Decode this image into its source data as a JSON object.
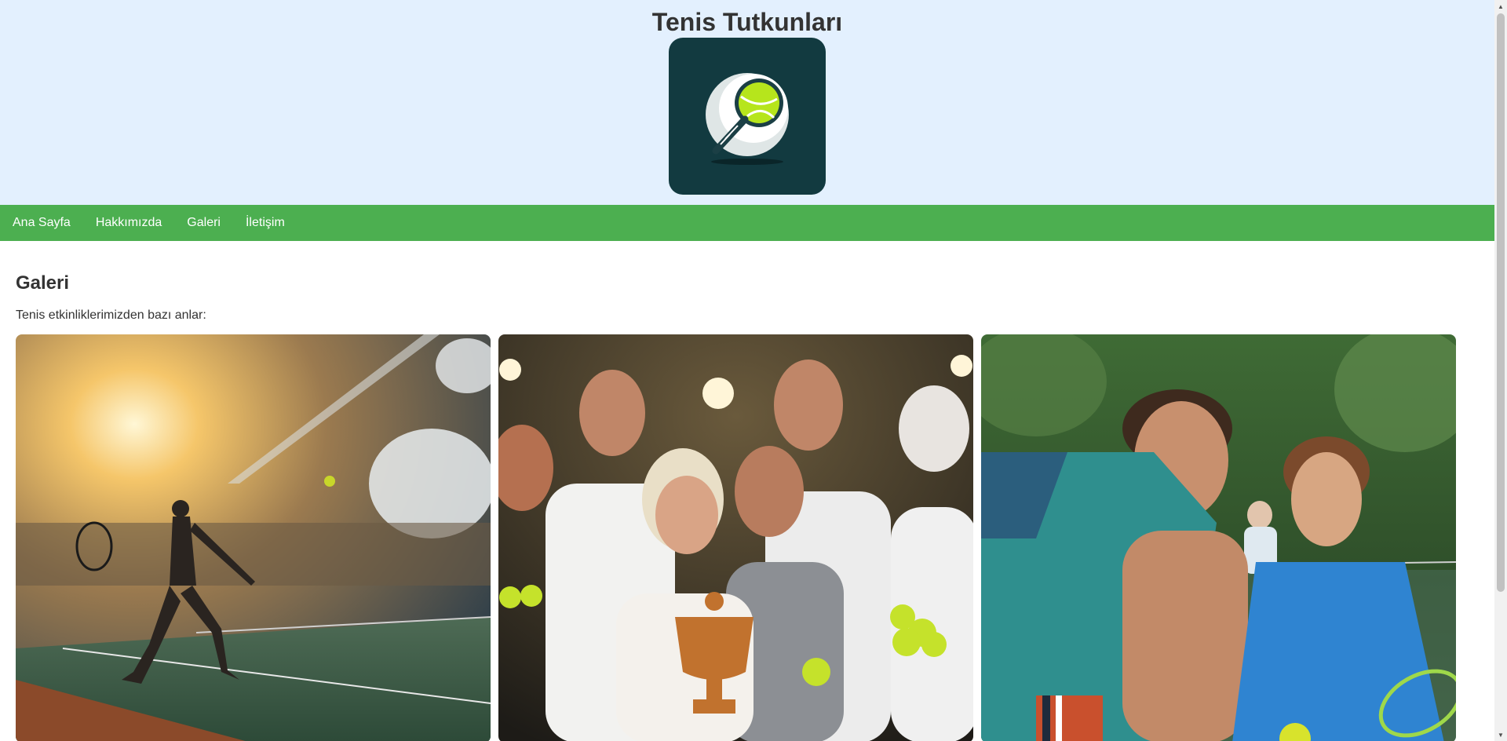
{
  "header": {
    "title": "Tenis Tutkunları",
    "logo_icon": "tennis-racket-ball-icon"
  },
  "nav": {
    "items": [
      {
        "label": "Ana Sayfa"
      },
      {
        "label": "Hakkımızda"
      },
      {
        "label": "Galeri"
      },
      {
        "label": "İletişim"
      }
    ]
  },
  "main": {
    "title": "Galeri",
    "description": "Tenis etkinliklerimizden bazı anlar:",
    "gallery": [
      {
        "subject": "tennis-player-serving"
      },
      {
        "subject": "group-with-trophy"
      },
      {
        "subject": "coach-teaching-boy"
      }
    ]
  },
  "colors": {
    "header_bg": "#e3f0fe",
    "nav_bg": "#4caf50",
    "logo_bg": "#123a40",
    "ball": "#b6e51c"
  }
}
